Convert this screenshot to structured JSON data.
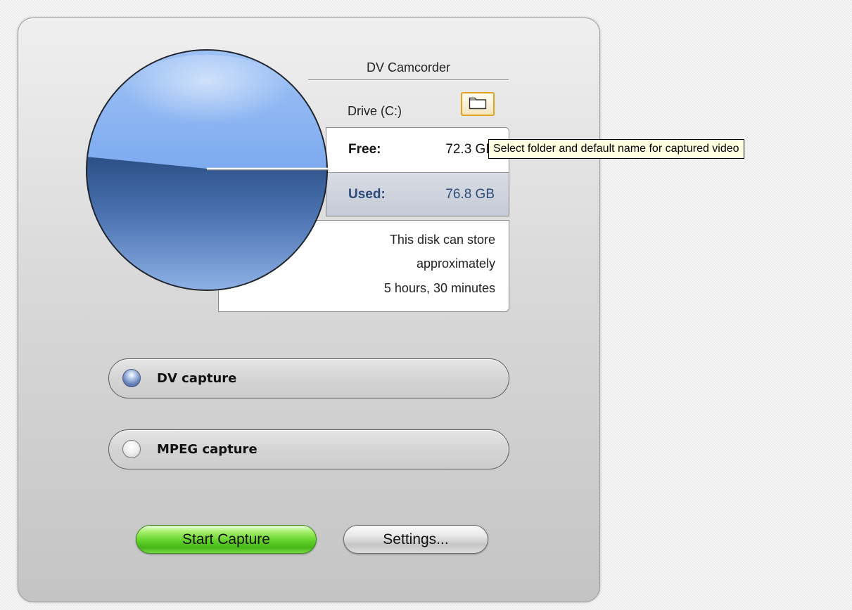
{
  "device": {
    "name": "DV Camcorder",
    "drive": "Drive (C:)"
  },
  "icons": {
    "folder": "folder-icon"
  },
  "disk": {
    "free_label": "Free:",
    "free_value": "72.3 GB",
    "used_label": "Used:",
    "used_value": "76.8 GB",
    "estimate_line1": "This disk can store",
    "estimate_line2": "approximately",
    "estimate_line3": "5 hours, 30 minutes"
  },
  "capture_modes": [
    {
      "label": "DV capture",
      "selected": true
    },
    {
      "label": "MPEG capture",
      "selected": false
    }
  ],
  "buttons": {
    "start": "Start Capture",
    "settings": "Settings..."
  },
  "tooltip": {
    "text": "Select folder and default name for captured video"
  },
  "colors": {
    "start_button": "#62d12a",
    "used_text": "#2e4d7a",
    "tooltip_bg": "#ffffe1",
    "folder_border": "#e0a41e"
  }
}
